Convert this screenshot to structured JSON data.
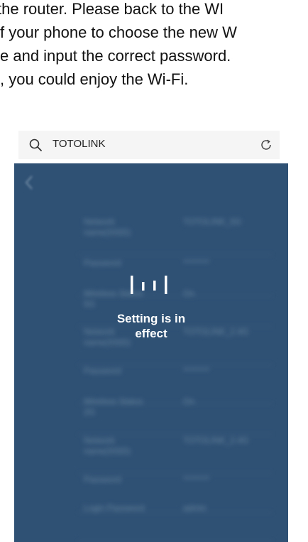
{
  "document": {
    "lines": [
      "the router. Please back to the WI",
      "f your phone to choose the new W",
      "e and input the correct password.",
      ", you could enjoy the Wi-Fi."
    ]
  },
  "browser": {
    "search_text": "TOTOLINK",
    "icons": {
      "search": "search-icon",
      "refresh": "refresh-icon"
    }
  },
  "screen": {
    "background_color": "#2f5174",
    "status_message": "Setting is in\neffect",
    "form_rows": [
      {
        "label": "Network name(SSID)",
        "value": "TOTOLINK_5G"
      },
      {
        "label": "Password",
        "value": "********"
      },
      {
        "label": "Wireless Status 5G",
        "value": "On"
      },
      {
        "label": "Network name(SSID)",
        "value": "TOTOLINK_2.4G"
      },
      {
        "label": "Password",
        "value": "********"
      },
      {
        "label": "Wireless Status 2G",
        "value": "On"
      },
      {
        "label": "Network name(SSID)",
        "value": "TOTOLINK_2.4G"
      },
      {
        "label": "Password",
        "value": "********"
      },
      {
        "label": "Login Password",
        "value": "admin"
      }
    ]
  }
}
